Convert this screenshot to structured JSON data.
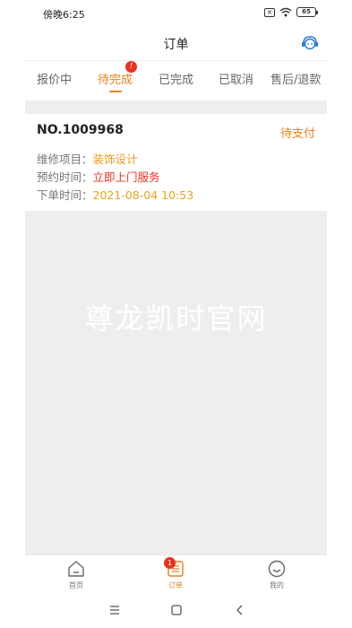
{
  "status_bar": {
    "time": "傍晚6:25",
    "battery": "65"
  },
  "header": {
    "title": "订单",
    "service_icon": "customer-service-icon"
  },
  "tabs": [
    {
      "label": "报价中",
      "active": false
    },
    {
      "label": "待完成",
      "active": true,
      "badge": "!"
    },
    {
      "label": "已完成",
      "active": false
    },
    {
      "label": "已取消",
      "active": false
    },
    {
      "label": "售后/退款",
      "active": false
    }
  ],
  "order": {
    "number": "NO.1009968",
    "status": "待支付",
    "fields": [
      {
        "label": "维修项目：",
        "value": "装饰设计"
      },
      {
        "label": "预约时间：",
        "value": "立即上门服务"
      },
      {
        "label": "下单时间：",
        "value": "2021-08-04 10:53"
      }
    ]
  },
  "watermark": "尊龙凯时官网",
  "bottom_nav": [
    {
      "label": "首页",
      "icon": "home-icon",
      "active": false
    },
    {
      "label": "订单",
      "icon": "orders-icon",
      "active": true,
      "badge": "1"
    },
    {
      "label": "我的",
      "icon": "profile-icon",
      "active": false
    }
  ],
  "colors": {
    "accent": "#ef7f1a",
    "badge": "#e8321e",
    "background": "#eeeeee"
  }
}
